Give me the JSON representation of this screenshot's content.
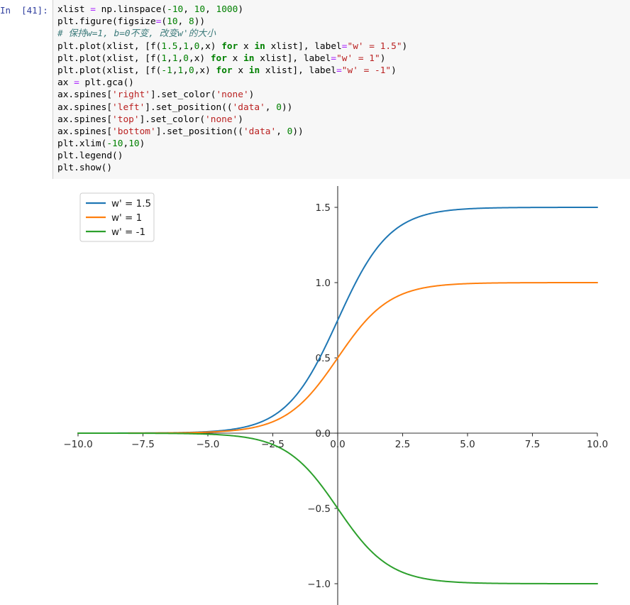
{
  "notebook": {
    "prompt_label": "In  [41]:",
    "code_lines": [
      [
        {
          "t": "xlist ",
          "c": "name"
        },
        {
          "t": "=",
          "c": "op"
        },
        {
          "t": " np.linspace(",
          "c": "name"
        },
        {
          "t": "-10",
          "c": "num"
        },
        {
          "t": ", ",
          "c": "name"
        },
        {
          "t": "10",
          "c": "num"
        },
        {
          "t": ", ",
          "c": "name"
        },
        {
          "t": "1000",
          "c": "num"
        },
        {
          "t": ")",
          "c": "name"
        }
      ],
      [
        {
          "t": "plt.figure(figsize",
          "c": "name"
        },
        {
          "t": "=",
          "c": "op"
        },
        {
          "t": "(",
          "c": "name"
        },
        {
          "t": "10",
          "c": "num"
        },
        {
          "t": ", ",
          "c": "name"
        },
        {
          "t": "8",
          "c": "num"
        },
        {
          "t": "))",
          "c": "name"
        }
      ],
      [
        {
          "t": "# 保持w=1, b=0不变, 改变w'的大小",
          "c": "com"
        }
      ],
      [
        {
          "t": "plt.plot(xlist, [f(",
          "c": "name"
        },
        {
          "t": "1.5",
          "c": "num"
        },
        {
          "t": ",",
          "c": "name"
        },
        {
          "t": "1",
          "c": "num"
        },
        {
          "t": ",",
          "c": "name"
        },
        {
          "t": "0",
          "c": "num"
        },
        {
          "t": ",x) ",
          "c": "name"
        },
        {
          "t": "for",
          "c": "kw"
        },
        {
          "t": " x ",
          "c": "name"
        },
        {
          "t": "in",
          "c": "kw"
        },
        {
          "t": " xlist], label",
          "c": "name"
        },
        {
          "t": "=",
          "c": "op"
        },
        {
          "t": "\"w' = 1.5\"",
          "c": "str"
        },
        {
          "t": ")",
          "c": "name"
        }
      ],
      [
        {
          "t": "plt.plot(xlist, [f(",
          "c": "name"
        },
        {
          "t": "1",
          "c": "num"
        },
        {
          "t": ",",
          "c": "name"
        },
        {
          "t": "1",
          "c": "num"
        },
        {
          "t": ",",
          "c": "name"
        },
        {
          "t": "0",
          "c": "num"
        },
        {
          "t": ",x) ",
          "c": "name"
        },
        {
          "t": "for",
          "c": "kw"
        },
        {
          "t": " x ",
          "c": "name"
        },
        {
          "t": "in",
          "c": "kw"
        },
        {
          "t": " xlist], label",
          "c": "name"
        },
        {
          "t": "=",
          "c": "op"
        },
        {
          "t": "\"w' = 1\"",
          "c": "str"
        },
        {
          "t": ")",
          "c": "name"
        }
      ],
      [
        {
          "t": "plt.plot(xlist, [f(",
          "c": "name"
        },
        {
          "t": "-1",
          "c": "num"
        },
        {
          "t": ",",
          "c": "name"
        },
        {
          "t": "1",
          "c": "num"
        },
        {
          "t": ",",
          "c": "name"
        },
        {
          "t": "0",
          "c": "num"
        },
        {
          "t": ",x) ",
          "c": "name"
        },
        {
          "t": "for",
          "c": "kw"
        },
        {
          "t": " x ",
          "c": "name"
        },
        {
          "t": "in",
          "c": "kw"
        },
        {
          "t": " xlist], label",
          "c": "name"
        },
        {
          "t": "=",
          "c": "op"
        },
        {
          "t": "\"w' = -1\"",
          "c": "str"
        },
        {
          "t": ")",
          "c": "name"
        }
      ],
      [
        {
          "t": "ax ",
          "c": "name"
        },
        {
          "t": "=",
          "c": "op"
        },
        {
          "t": " plt.gca()",
          "c": "name"
        }
      ],
      [
        {
          "t": "ax.spines[",
          "c": "name"
        },
        {
          "t": "'right'",
          "c": "str"
        },
        {
          "t": "].set_color(",
          "c": "name"
        },
        {
          "t": "'none'",
          "c": "str"
        },
        {
          "t": ")",
          "c": "name"
        }
      ],
      [
        {
          "t": "ax.spines[",
          "c": "name"
        },
        {
          "t": "'left'",
          "c": "str"
        },
        {
          "t": "].set_position((",
          "c": "name"
        },
        {
          "t": "'data'",
          "c": "str"
        },
        {
          "t": ", ",
          "c": "name"
        },
        {
          "t": "0",
          "c": "num"
        },
        {
          "t": "))",
          "c": "name"
        }
      ],
      [
        {
          "t": "ax.spines[",
          "c": "name"
        },
        {
          "t": "'top'",
          "c": "str"
        },
        {
          "t": "].set_color(",
          "c": "name"
        },
        {
          "t": "'none'",
          "c": "str"
        },
        {
          "t": ")",
          "c": "name"
        }
      ],
      [
        {
          "t": "ax.spines[",
          "c": "name"
        },
        {
          "t": "'bottom'",
          "c": "str"
        },
        {
          "t": "].set_position((",
          "c": "name"
        },
        {
          "t": "'data'",
          "c": "str"
        },
        {
          "t": ", ",
          "c": "name"
        },
        {
          "t": "0",
          "c": "num"
        },
        {
          "t": "))",
          "c": "name"
        }
      ],
      [
        {
          "t": "plt.xlim(",
          "c": "name"
        },
        {
          "t": "-10",
          "c": "num"
        },
        {
          "t": ",",
          "c": "name"
        },
        {
          "t": "10",
          "c": "num"
        },
        {
          "t": ")",
          "c": "name"
        }
      ],
      [
        {
          "t": "plt.legend()",
          "c": "name"
        }
      ],
      [
        {
          "t": "plt.show()",
          "c": "name"
        }
      ]
    ]
  },
  "chart_data": {
    "type": "line",
    "title": "",
    "xlabel": "",
    "ylabel": "",
    "xlim": [
      -10,
      10
    ],
    "ylim": [
      -1.25,
      1.72
    ],
    "grid": false,
    "spines": "centered-at-origin",
    "xticks": [
      -10.0,
      -7.5,
      -5.0,
      -2.5,
      0.0,
      2.5,
      5.0,
      7.5,
      10.0
    ],
    "xtick_labels": [
      "-10.0",
      "-7.5",
      "-5.0",
      "-2.5",
      "0.0",
      "2.5",
      "5.0",
      "7.5",
      "10.0"
    ],
    "yticks": [
      1.5,
      1.0,
      0.5,
      0.0,
      -0.5,
      -1.0
    ],
    "ytick_labels": [
      "1.5",
      "1.0",
      "0.5",
      "0.0",
      "-0.5",
      "-1.0"
    ],
    "legend_position": "upper left",
    "series": [
      {
        "name": "w' = 1.5",
        "color": "#1f77b4",
        "formula": "1.5 / (1 + exp(-(1*x + 0)))",
        "amplitude": 1.5,
        "x": [
          -10,
          -9,
          -8,
          -7,
          -6,
          -5,
          -4,
          -3,
          -2.5,
          -2,
          -1.5,
          -1,
          -0.5,
          0,
          0.5,
          1,
          1.5,
          2,
          2.5,
          3,
          4,
          5,
          6,
          7,
          8,
          9,
          10
        ],
        "y": [
          0.0001,
          0.0002,
          0.0005,
          0.0014,
          0.0037,
          0.0101,
          0.0269,
          0.0714,
          0.1142,
          0.1792,
          0.2723,
          0.4034,
          0.5739,
          0.75,
          0.9261,
          1.0966,
          1.2277,
          1.3208,
          1.3858,
          1.4286,
          1.4731,
          1.4899,
          1.4963,
          1.4986,
          1.4995,
          1.4998,
          1.4999
        ]
      },
      {
        "name": "w' = 1",
        "color": "#ff7f0e",
        "formula": "1.0 / (1 + exp(-(1*x + 0)))",
        "amplitude": 1.0,
        "x": [
          -10,
          -9,
          -8,
          -7,
          -6,
          -5,
          -4,
          -3,
          -2.5,
          -2,
          -1.5,
          -1,
          -0.5,
          0,
          0.5,
          1,
          1.5,
          2,
          2.5,
          3,
          4,
          5,
          6,
          7,
          8,
          9,
          10
        ],
        "y": [
          5e-05,
          0.0001,
          0.0003,
          0.0009,
          0.0025,
          0.0067,
          0.018,
          0.0474,
          0.0759,
          0.1192,
          0.1824,
          0.2689,
          0.3775,
          0.5,
          0.6225,
          0.7311,
          0.8176,
          0.8808,
          0.9241,
          0.9526,
          0.982,
          0.9933,
          0.9975,
          0.9991,
          0.9997,
          0.9999,
          0.99995
        ]
      },
      {
        "name": "w' = -1",
        "color": "#2ca02c",
        "formula": "-1.0 / (1 + exp(-(1*x + 0)))",
        "amplitude": -1.0,
        "x": [
          -10,
          -9,
          -8,
          -7,
          -6,
          -5,
          -4,
          -3,
          -2.5,
          -2,
          -1.5,
          -1,
          -0.5,
          0,
          0.5,
          1,
          1.5,
          2,
          2.5,
          3,
          4,
          5,
          6,
          7,
          8,
          9,
          10
        ],
        "y": [
          -5e-05,
          -0.0001,
          -0.0003,
          -0.0009,
          -0.0025,
          -0.0067,
          -0.018,
          -0.0474,
          -0.0759,
          -0.1192,
          -0.1824,
          -0.2689,
          -0.3775,
          -0.5,
          -0.6225,
          -0.7311,
          -0.8176,
          -0.8808,
          -0.9241,
          -0.9526,
          -0.982,
          -0.9933,
          -0.9975,
          -0.9991,
          -0.9997,
          -0.9999,
          -0.99995
        ]
      }
    ],
    "legend_entries": [
      {
        "label": "w' = 1.5",
        "color": "#1f77b4"
      },
      {
        "label": "w' = 1",
        "color": "#ff7f0e"
      },
      {
        "label": "w' = -1",
        "color": "#2ca02c"
      }
    ]
  }
}
